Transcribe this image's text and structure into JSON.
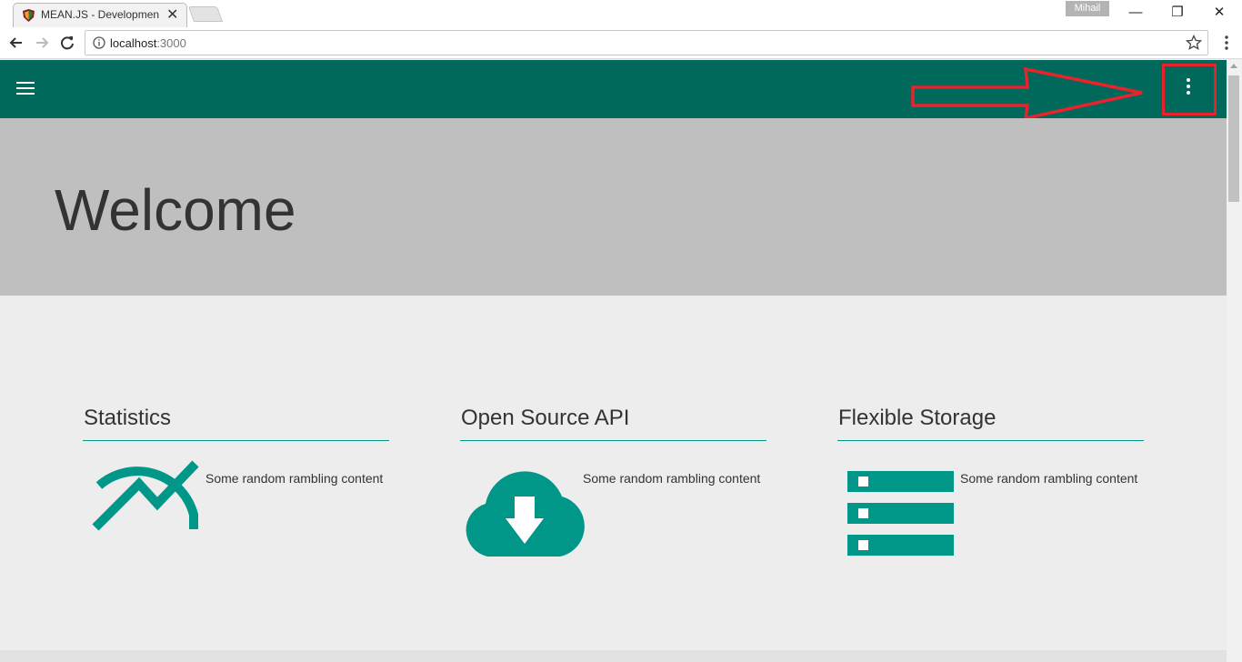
{
  "browser": {
    "tab_title": "MEAN.JS - Development",
    "tab_close": "✕",
    "profile_name": "Mihail",
    "window_controls": {
      "minimize": "—",
      "restore": "❐",
      "close": "✕"
    },
    "address_host": "localhost",
    "address_port": ":3000"
  },
  "app": {
    "brand_color": "#00695c",
    "accent_color": "#009688",
    "menu_icon": "hamburger-menu-icon",
    "overflow_icon": "more-vert-icon"
  },
  "annotation": {
    "color": "#e8232b",
    "arrow": "arrow-right",
    "box": "highlight-box"
  },
  "hero": {
    "title": "Welcome"
  },
  "features": [
    {
      "title": "Statistics",
      "icon": "trending-chart-icon",
      "text": "Some random rambling content"
    },
    {
      "title": "Open Source API",
      "icon": "cloud-download-icon",
      "text": "Some random rambling content"
    },
    {
      "title": "Flexible Storage",
      "icon": "storage-icon",
      "text": "Some random rambling content"
    }
  ]
}
